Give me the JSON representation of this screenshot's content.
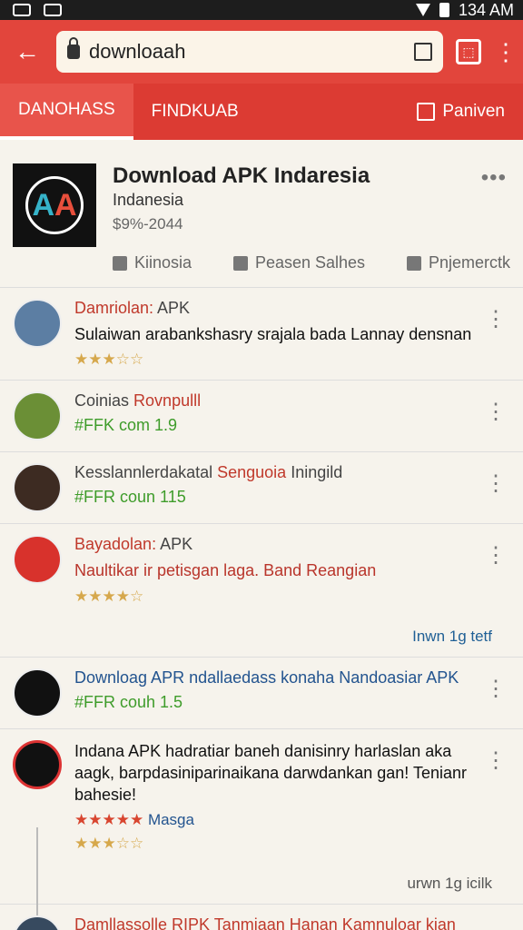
{
  "status": {
    "time": "134 AM"
  },
  "browser": {
    "url": "downloaah"
  },
  "tabs": {
    "tab1": "DANOHASS",
    "tab2": "FINDKUAB",
    "action": "Paniven"
  },
  "app": {
    "title": "Download APK Indaresia",
    "subtitle": "Indanesia",
    "price": "$9%-2044",
    "actions": {
      "like": "Kiinosia",
      "comment": "Peasen Salhes",
      "share": "Pnjemerctk"
    }
  },
  "feed": [
    {
      "name": "Damriolan:",
      "tag": "APK",
      "text": "Sulaiwan arabankshasry srajala bada Lannay densnan",
      "stars": "★★★☆☆"
    },
    {
      "name": "Coinias",
      "tag": "Rovnpulll",
      "text": "#FFK com 1.9"
    },
    {
      "name": "Kesslannlerdakatal",
      "tag": "Senguoia",
      "extra": "Iningild",
      "text": "#FFR coun 115"
    },
    {
      "name": "Bayadolan:",
      "tag": "APK",
      "text": "Naultikar ir petisgan laga. Band Reangian",
      "stars": "★★★★☆",
      "link": "Inwn 1g tetf"
    },
    {
      "name": "Downloag APR ndallaedass konaha Nandoasiar APK",
      "text": "#FFR couh 1.5"
    },
    {
      "text": "Indana APK hadratiar baneh danisinry harlaslan aka aagk, barpdasiniparinaikana darwdankan gan! Tenianr bahesie!",
      "stars2": "★★★★★",
      "tag": "Masga",
      "stars": "★★★☆☆",
      "link": "urwn 1g icilk"
    },
    {
      "name": "Damllassolle RIPK Tanmiaan Hanan Kamnuloar kian"
    }
  ]
}
